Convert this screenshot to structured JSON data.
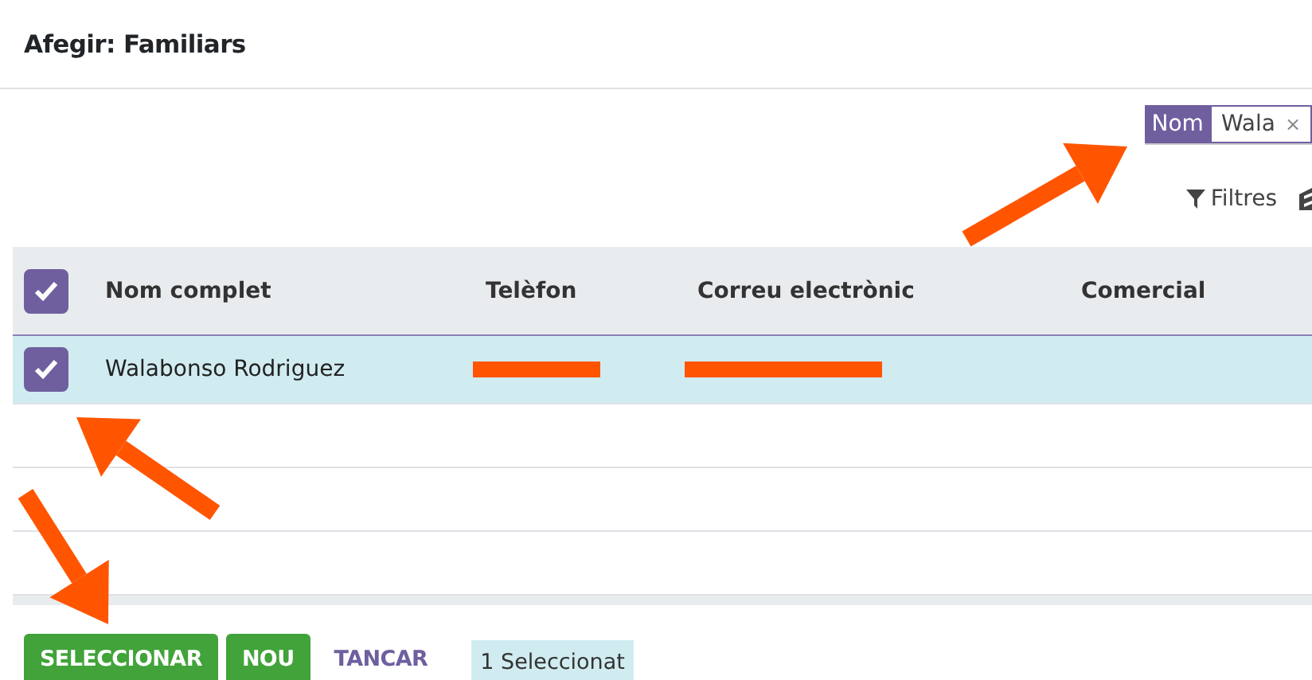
{
  "dialog": {
    "title": "Afegir: Familiars"
  },
  "search": {
    "facets": [
      {
        "field": "Nom",
        "value": "Wala",
        "remove": "×"
      }
    ]
  },
  "filters_button": {
    "label": "Filtres"
  },
  "table": {
    "all_checked": true,
    "columns": [
      "Nom complet",
      "Telèfon",
      "Correu electrònic",
      "Comercial"
    ],
    "rows": [
      {
        "checked": true,
        "selected": true,
        "name": "Walabonso Rodriguez",
        "phone_redacted": true,
        "email_redacted": true
      }
    ]
  },
  "footer": {
    "buttons": [
      {
        "label": "SELECCIONAR",
        "kind": "primary"
      },
      {
        "label": "NOU",
        "kind": "primary"
      },
      {
        "label": "TANCAR",
        "kind": "link"
      }
    ],
    "selection_badge": "1 Seleccionat"
  }
}
